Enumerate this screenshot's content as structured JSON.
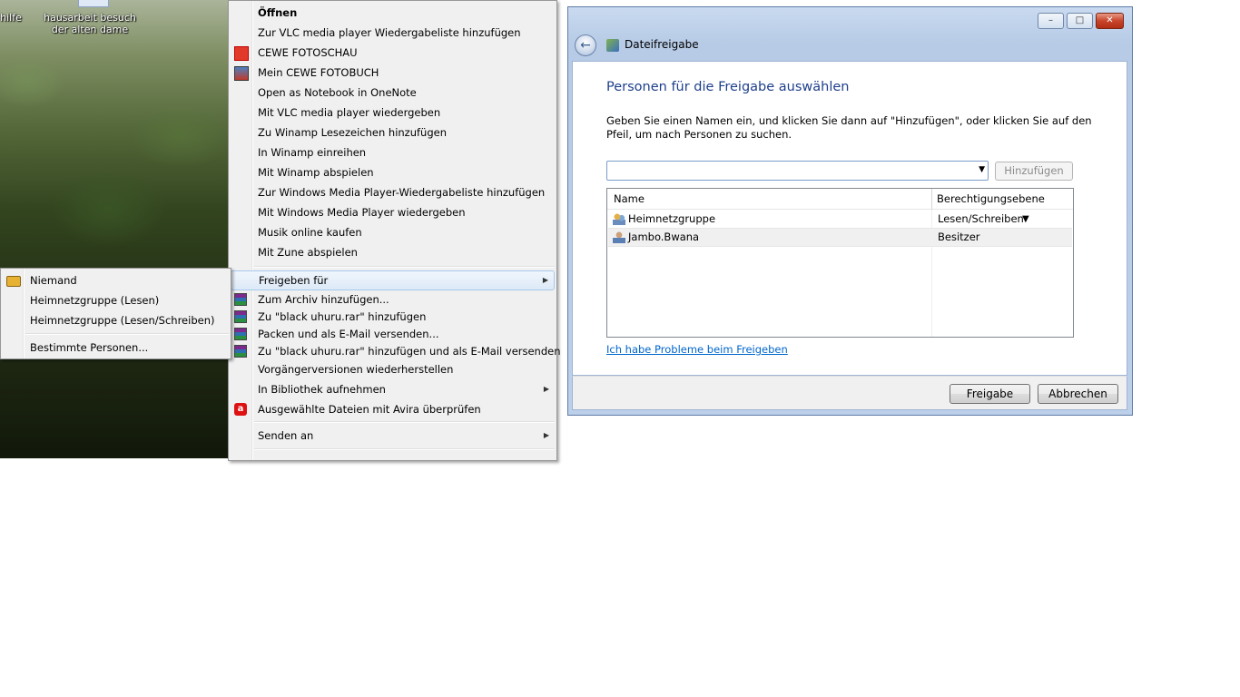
{
  "desktop": {
    "icon_labels": [
      {
        "text": "hilfe"
      },
      {
        "text": "hausarbeit besuch der alten dame"
      }
    ]
  },
  "context_menu": {
    "items": [
      {
        "label": "Öffnen",
        "bold": true
      },
      {
        "label": "Zur VLC media player Wiedergabeliste hinzufügen"
      },
      {
        "label": "CEWE FOTOSCHAU",
        "icon": "cewe-icon"
      },
      {
        "label": "Mein CEWE FOTOBUCH",
        "icon": "cewe-fotobuch-icon"
      },
      {
        "label": "Open as Notebook in OneNote"
      },
      {
        "label": "Mit VLC media player wiedergeben"
      },
      {
        "label": "Zu Winamp Lesezeichen hinzufügen"
      },
      {
        "label": "In Winamp einreihen"
      },
      {
        "label": "Mit Winamp abspielen"
      },
      {
        "label": "Zur Windows Media Player-Wiedergabeliste hinzufügen"
      },
      {
        "label": "Mit Windows Media Player wiedergeben"
      },
      {
        "label": "Musik online kaufen"
      },
      {
        "label": "Mit Zune abspielen"
      },
      {
        "label": "Freigeben für",
        "submenu": true,
        "highlighted": true
      },
      {
        "label": "Zum Archiv hinzufügen...",
        "icon": "winrar-icon"
      },
      {
        "label": "Zu \"black uhuru.rar\" hinzufügen",
        "icon": "winrar-icon"
      },
      {
        "label": "Packen und als E-Mail versenden...",
        "icon": "winrar-icon"
      },
      {
        "label": "Zu \"black uhuru.rar\" hinzufügen und als E-Mail versenden",
        "icon": "winrar-icon"
      },
      {
        "label": "Vorgängerversionen wiederherstellen"
      },
      {
        "label": "In Bibliothek aufnehmen",
        "submenu": true
      },
      {
        "label": "Ausgewählte Dateien mit Avira überprüfen",
        "icon": "avira-icon"
      },
      {
        "label": "Senden an",
        "submenu": true
      }
    ]
  },
  "share_submenu": {
    "items": [
      {
        "label": "Niemand",
        "icon": "lock-icon"
      },
      {
        "label": "Heimnetzgruppe (Lesen)"
      },
      {
        "label": "Heimnetzgruppe (Lesen/Schreiben)"
      },
      {
        "label": "Bestimmte Personen..."
      }
    ]
  },
  "dialog": {
    "title": "Dateifreigabe",
    "heading": "Personen für die Freigabe auswählen",
    "instruction": "Geben Sie einen Namen ein, und klicken Sie dann auf \"Hinzufügen\", oder klicken Sie auf den Pfeil, um nach Personen zu suchen.",
    "name_input": {
      "value": ""
    },
    "add_button": "Hinzufügen",
    "columns": {
      "name": "Name",
      "permission": "Berechtigungsebene"
    },
    "rows": [
      {
        "name": "Heimnetzgruppe",
        "permission": "Lesen/Schreiben",
        "icon": "homegroup-icon"
      },
      {
        "name": "Jambo.Bwana",
        "permission": "Besitzer",
        "icon": "user-icon"
      }
    ],
    "help_link": "Ich habe Probleme beim Freigeben",
    "share_button": "Freigabe",
    "cancel_button": "Abbrechen"
  }
}
